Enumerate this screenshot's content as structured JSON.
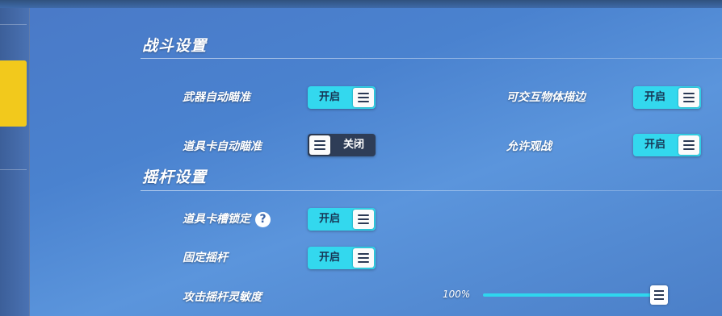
{
  "sections": {
    "combat": {
      "title": "战斗设置"
    },
    "joystick": {
      "title": "摇杆设置"
    }
  },
  "combat_settings": {
    "weapon_auto_aim": {
      "label": "武器自动瞄准",
      "state": "开启"
    },
    "interactable_outline": {
      "label": "可交互物体描边",
      "state": "开启"
    },
    "item_card_auto_aim": {
      "label": "道具卡自动瞄准",
      "state": "关闭"
    },
    "allow_spectate": {
      "label": "允许观战",
      "state": "开启"
    }
  },
  "joystick_settings": {
    "item_slot_lock": {
      "label": "道具卡槽锁定",
      "state": "开启",
      "help_icon": "?"
    },
    "fixed_joystick": {
      "label": "固定摇杆",
      "state": "开启"
    },
    "attack_sensitivity": {
      "label": "攻击摇杆灵敏度",
      "value_text": "100%",
      "value": 1.0
    }
  },
  "colors": {
    "toggle_on": "#33d8ee",
    "toggle_off": "#2e3d57",
    "active_tab": "#f2c91c"
  }
}
